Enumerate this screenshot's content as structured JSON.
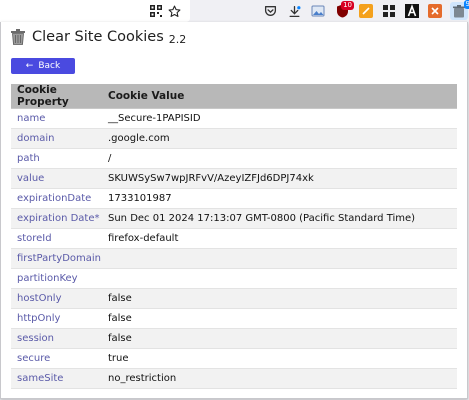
{
  "toolbar": {
    "icons": [
      {
        "name": "qr-code-icon"
      },
      {
        "name": "bookmark-star-icon"
      },
      {
        "name": "pocket-icon"
      },
      {
        "name": "download-icon"
      },
      {
        "name": "extension-image-icon"
      },
      {
        "name": "ublock-icon",
        "badge": "10"
      },
      {
        "name": "extension-orange-icon"
      },
      {
        "name": "extension-grid-icon"
      },
      {
        "name": "font-a-icon"
      },
      {
        "name": "extension-close-icon"
      },
      {
        "name": "clear-cookies-extension-icon",
        "badge": "9"
      }
    ],
    "colors": {
      "accent": "#0a84ff",
      "badge": "#d70022"
    }
  },
  "app": {
    "title": "Clear Site Cookies",
    "version": "2.2",
    "icon": "trash-can-icon"
  },
  "back_button": {
    "label": "Back",
    "icon": "left-arrow-icon",
    "color": "#4a4ae0"
  },
  "table": {
    "headers": {
      "property": "Cookie Property",
      "value": "Cookie Value"
    },
    "rows": [
      {
        "property": "name",
        "value": "__Secure-1PAPISID"
      },
      {
        "property": "domain",
        "value": ".google.com"
      },
      {
        "property": "path",
        "value": "/"
      },
      {
        "property": "value",
        "value": "SKUWSySw7wpJRFvV/AzeyIZFJd6DPJ74xk"
      },
      {
        "property": "expirationDate",
        "value": "1733101987"
      },
      {
        "property": "expiration Date*",
        "value": "Sun Dec 01 2024 17:13:07 GMT-0800 (Pacific Standard Time)"
      },
      {
        "property": "storeId",
        "value": "firefox-default"
      },
      {
        "property": "firstPartyDomain",
        "value": ""
      },
      {
        "property": "partitionKey",
        "value": ""
      },
      {
        "property": "hostOnly",
        "value": "false"
      },
      {
        "property": "httpOnly",
        "value": "false"
      },
      {
        "property": "session",
        "value": "false"
      },
      {
        "property": "secure",
        "value": "true"
      },
      {
        "property": "sameSite",
        "value": "no_restriction"
      }
    ]
  }
}
